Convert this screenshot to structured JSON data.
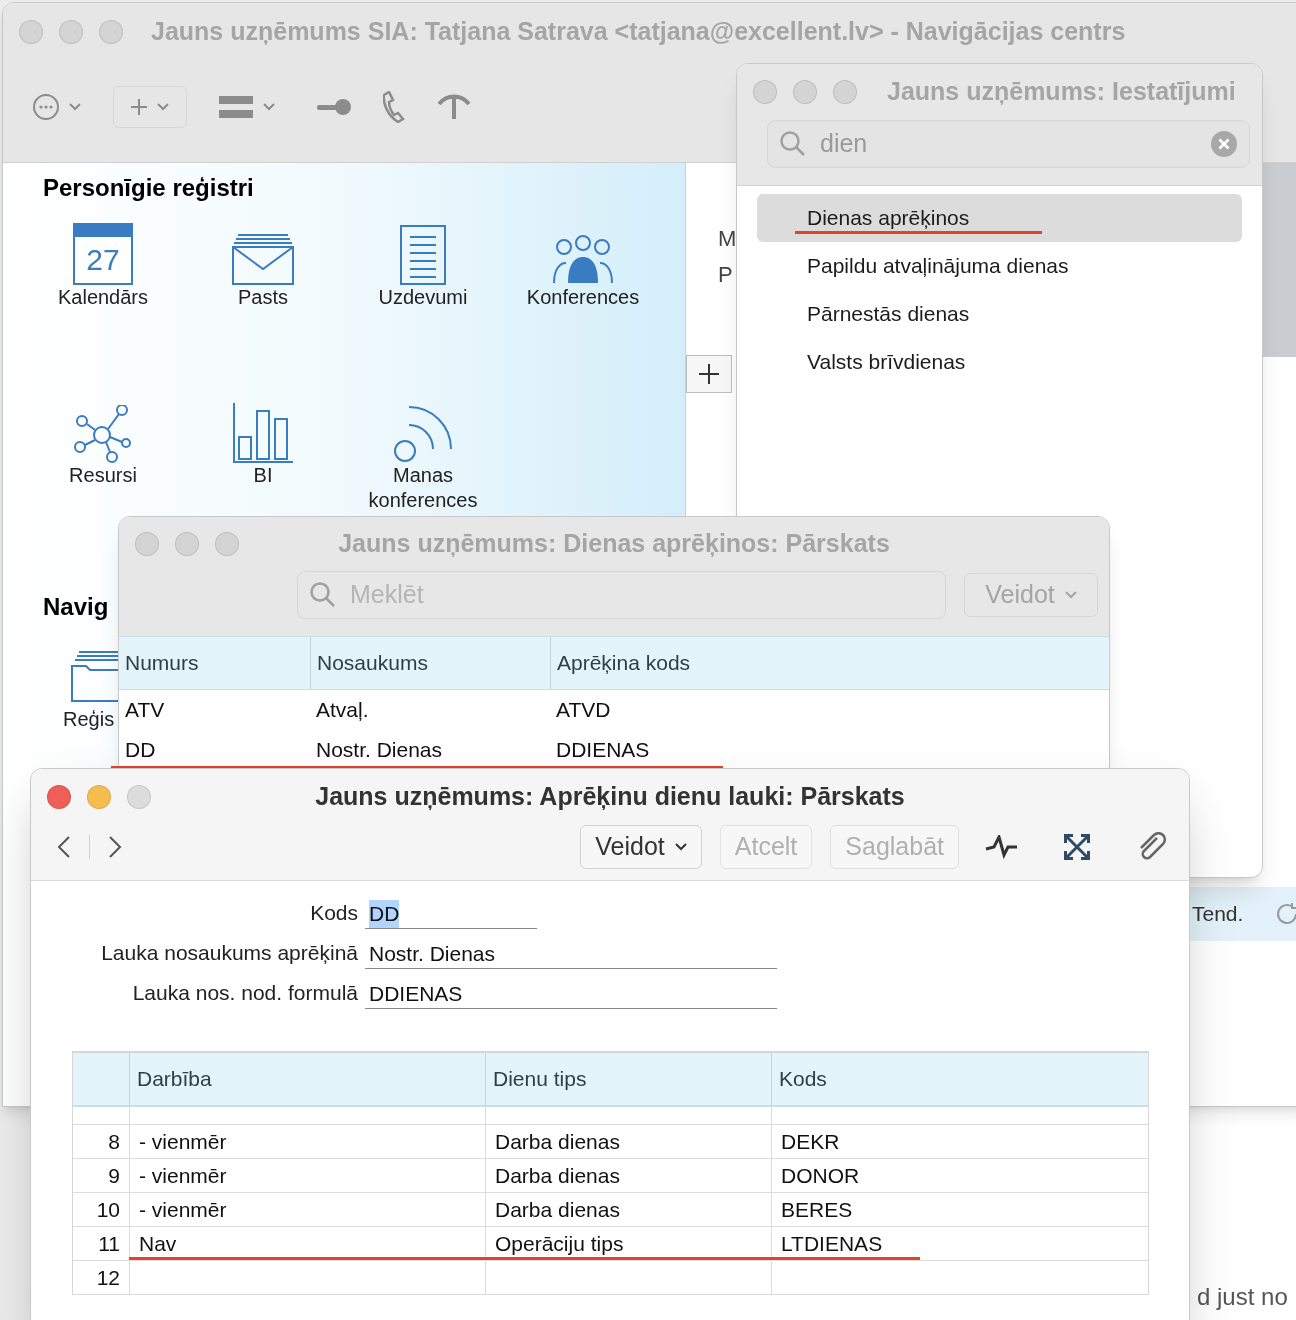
{
  "main_window": {
    "title": "Jauns uzņēmums SIA: Tatjana Satrava <tatjana@excellent.lv> - Navigācijas centrs",
    "active": false,
    "section_title": "Personīgie reģistri",
    "registers": [
      {
        "kind": "calendar",
        "label": "Kalendārs",
        "date": "27"
      },
      {
        "kind": "mail",
        "label": "Pasts"
      },
      {
        "kind": "tasks",
        "label": "Uzdevumi"
      },
      {
        "kind": "conferences",
        "label": "Konferences"
      },
      {
        "kind": "resources",
        "label": "Resursi"
      },
      {
        "kind": "bi",
        "label": "BI"
      },
      {
        "kind": "broadcast",
        "label": "Manas konferences"
      }
    ],
    "nav_title": "Navig",
    "nav_items": [
      {
        "kind": "folder",
        "label": "Reģis"
      }
    ],
    "side_letters": [
      "M",
      "P"
    ],
    "tend_label": "Tend."
  },
  "settings_window": {
    "title": "Jauns uzņēmums: Iestatījumi",
    "active": false,
    "search": {
      "value": "dien"
    },
    "items": [
      {
        "label": "Dienas aprēķinos",
        "selected": true,
        "underlined": true
      },
      {
        "label": "Papildu atvaļinājuma dienas",
        "selected": false,
        "underlined": false
      },
      {
        "label": "Pārnestās dienas",
        "selected": false,
        "underlined": false
      },
      {
        "label": "Valsts brīvdienas",
        "selected": false,
        "underlined": false
      }
    ]
  },
  "overview_window": {
    "title": "Jauns uzņēmums: Dienas aprēķinos: Pārskats",
    "active": false,
    "search": {
      "placeholder": "Meklēt"
    },
    "create_button": "Veidot",
    "columns": [
      "Numurs",
      "Nosaukums",
      "Aprēķina kods"
    ],
    "rows": [
      {
        "cells": [
          "ATV",
          "Atvaļ.",
          "ATVD"
        ],
        "underlined": false
      },
      {
        "cells": [
          "DD",
          "Nostr. Dienas",
          "DDIENAS"
        ],
        "underlined": true
      }
    ]
  },
  "form_window": {
    "title": "Jauns uzņēmums: Aprēķinu dienu lauki: Pārskats",
    "active": true,
    "buttons": [
      {
        "label": "Veidot",
        "kind": "menu",
        "disabled": false
      },
      {
        "label": "Atcelt",
        "kind": "plain",
        "disabled": true
      },
      {
        "label": "Saglabāt",
        "kind": "plain",
        "disabled": true
      }
    ],
    "fields": [
      {
        "label": "Kods",
        "value": "DD",
        "selected": true
      },
      {
        "label": "Lauka nosaukums aprēķinā",
        "value": "Nostr. Dienas",
        "selected": false
      },
      {
        "label": "Lauka nos. nod. formulā",
        "value": "DDIENAS",
        "selected": false
      }
    ],
    "table": {
      "columns": [
        "Darbība",
        "Dienu tips",
        "Kods"
      ],
      "rows": [
        {
          "number": "8",
          "cells": [
            "- vienmēr",
            "Darba dienas",
            "DEKR"
          ],
          "underlined": false
        },
        {
          "number": "9",
          "cells": [
            "- vienmēr",
            "Darba dienas",
            "DONOR"
          ],
          "underlined": false
        },
        {
          "number": "10",
          "cells": [
            "- vienmēr",
            "Darba dienas",
            "BERES"
          ],
          "underlined": false
        },
        {
          "number": "11",
          "cells": [
            "Nav",
            "Operāciju tips",
            "LTDIENAS"
          ],
          "underlined": true
        },
        {
          "number": "12",
          "cells": [],
          "underlined": false
        }
      ]
    }
  },
  "back_window": {
    "text": "d just no"
  }
}
